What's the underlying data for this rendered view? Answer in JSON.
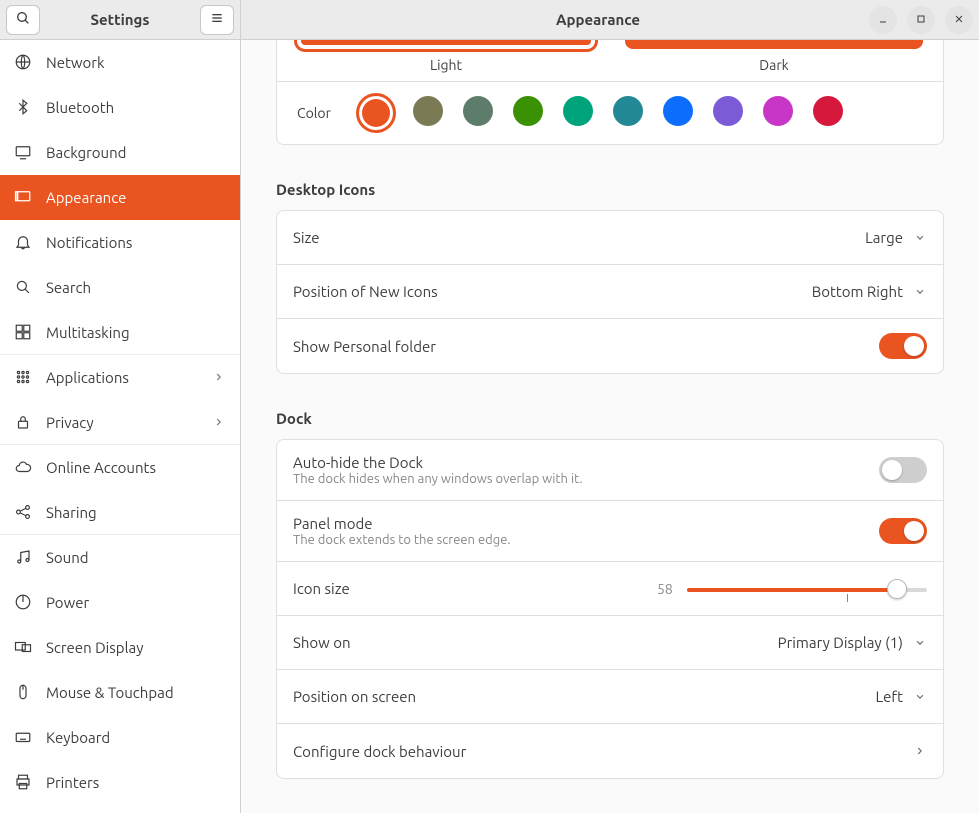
{
  "app_title": "Settings",
  "page_title": "Appearance",
  "accent": "#e95420",
  "sidebar": {
    "items": [
      {
        "label": "Network",
        "icon": "globe"
      },
      {
        "label": "Bluetooth",
        "icon": "bluetooth"
      },
      {
        "label": "Background",
        "icon": "display"
      },
      {
        "label": "Appearance",
        "icon": "display-dock",
        "active": true
      },
      {
        "label": "Notifications",
        "icon": "bell"
      },
      {
        "label": "Search",
        "icon": "search"
      },
      {
        "label": "Multitasking",
        "icon": "multitask",
        "sep": true
      },
      {
        "label": "Applications",
        "icon": "apps",
        "chevron": true
      },
      {
        "label": "Privacy",
        "icon": "lock",
        "chevron": true,
        "sep": true
      },
      {
        "label": "Online Accounts",
        "icon": "cloud"
      },
      {
        "label": "Sharing",
        "icon": "share",
        "sep": true
      },
      {
        "label": "Sound",
        "icon": "music"
      },
      {
        "label": "Power",
        "icon": "power"
      },
      {
        "label": "Screen Display",
        "icon": "screens"
      },
      {
        "label": "Mouse & Touchpad",
        "icon": "mouse"
      },
      {
        "label": "Keyboard",
        "icon": "keyboard"
      },
      {
        "label": "Printers",
        "icon": "printer"
      }
    ]
  },
  "theme": {
    "light_label": "Light",
    "dark_label": "Dark",
    "selected": "light",
    "color_label": "Color",
    "colors": [
      "#e95420",
      "#7a7a54",
      "#5e7c6b",
      "#3a9104",
      "#00a47c",
      "#238997",
      "#0d6efd",
      "#7b5cd6",
      "#c736c7",
      "#d6183d"
    ],
    "selected_color_index": 0
  },
  "desktop_icons": {
    "title": "Desktop Icons",
    "size_label": "Size",
    "size_value": "Large",
    "position_label": "Position of New Icons",
    "position_value": "Bottom Right",
    "personal_label": "Show Personal folder",
    "personal_on": true
  },
  "dock": {
    "title": "Dock",
    "autohide_label": "Auto-hide the Dock",
    "autohide_sub": "The dock hides when any windows overlap with it.",
    "autohide_on": false,
    "panel_label": "Panel mode",
    "panel_sub": "The dock extends to the screen edge.",
    "panel_on": true,
    "iconsize_label": "Icon size",
    "iconsize_value": 58,
    "iconsize_min": 16,
    "iconsize_max": 64,
    "showon_label": "Show on",
    "showon_value": "Primary Display (1)",
    "position_label": "Position on screen",
    "position_value": "Left",
    "configure_label": "Configure dock behaviour"
  }
}
